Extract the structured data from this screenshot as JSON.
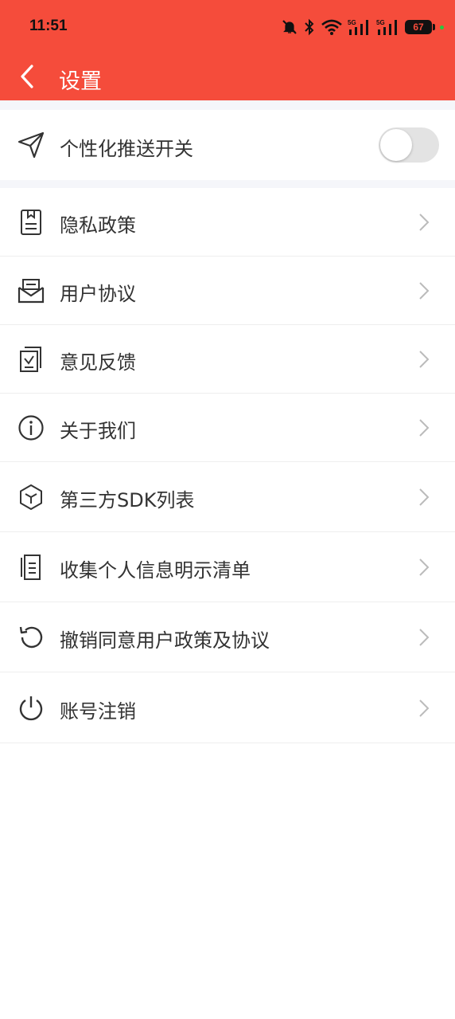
{
  "status_bar": {
    "time": "11:51",
    "battery": "67",
    "icons": [
      "bell-off-icon",
      "bluetooth-icon",
      "wifi-icon",
      "signal-5g-icon",
      "signal-5g-icon",
      "battery-icon"
    ]
  },
  "header": {
    "title": "设置",
    "background_color": "#f54c3b"
  },
  "push_toggle": {
    "label": "个性化推送开关",
    "icon": "send-icon",
    "enabled": false
  },
  "menu": {
    "items": [
      {
        "label": "隐私政策",
        "icon": "document-icon"
      },
      {
        "label": "用户协议",
        "icon": "envelope-icon"
      },
      {
        "label": "意见反馈",
        "icon": "feedback-icon"
      },
      {
        "label": "关于我们",
        "icon": "info-icon"
      },
      {
        "label": "第三方SDK列表",
        "icon": "cube-icon"
      },
      {
        "label": "收集个人信息明示清单",
        "icon": "copy-doc-icon"
      },
      {
        "label": "撤销同意用户政策及协议",
        "icon": "revoke-icon"
      },
      {
        "label": "账号注销",
        "icon": "power-icon"
      }
    ]
  }
}
